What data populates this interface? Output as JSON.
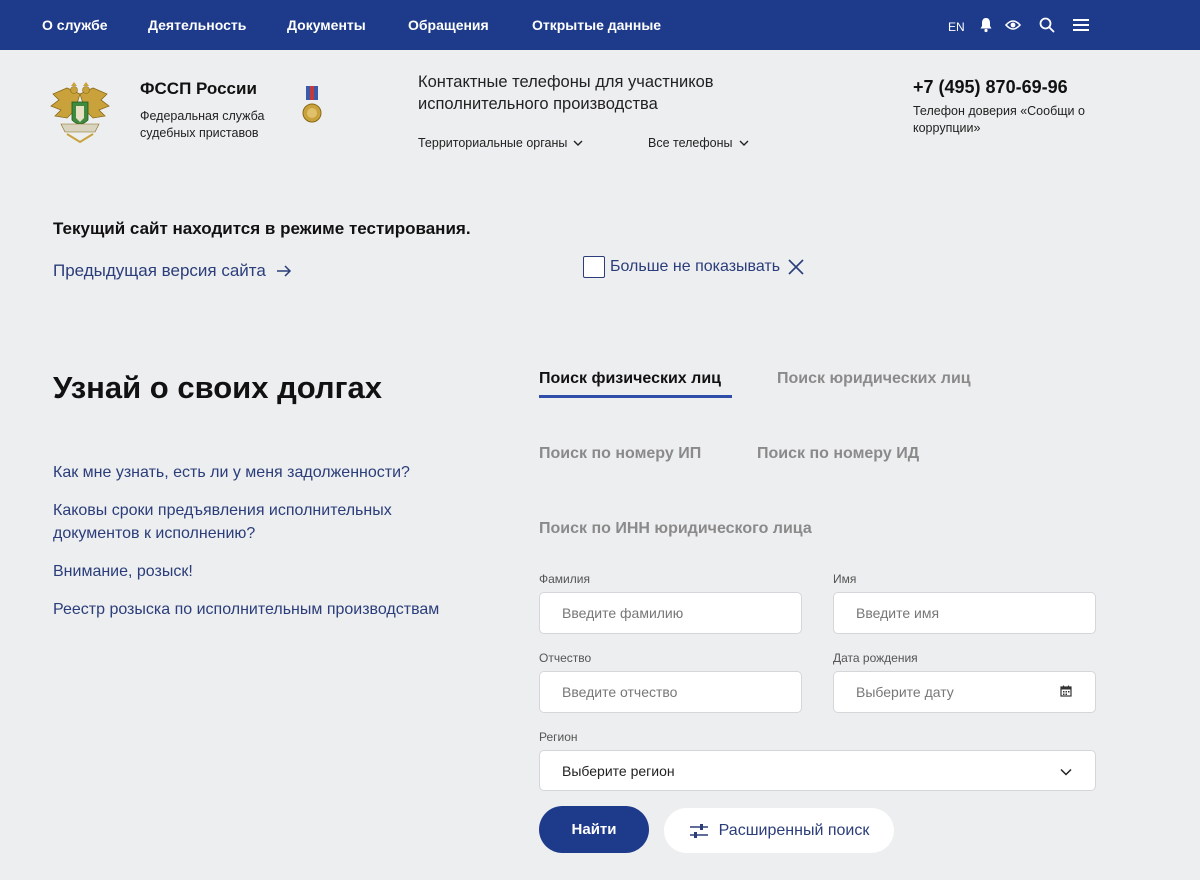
{
  "topnav": {
    "items": [
      "О службе",
      "Деятельность",
      "Документы",
      "Обращения",
      "Открытые данные"
    ],
    "lang": "EN",
    "icons": [
      "bell-icon",
      "eye-icon",
      "search-icon",
      "menu-icon"
    ]
  },
  "brand": {
    "title": "ФССП России",
    "subtitle": "Федеральная служба судебных приставов"
  },
  "contacts": {
    "title": "Контактные телефоны для участников исполнительного производства",
    "territorial": "Территориальные органы",
    "all_phones": "Все телефоны"
  },
  "hotline": {
    "phone": "+7 (495) 870-69-96",
    "label": "Телефон доверия «Сообщи о коррупции»"
  },
  "notice": {
    "text": "Текущий сайт находится в режиме тестирования.",
    "prev_link": "Предыдущая версия сайта",
    "dont_show": "Больше не показывать"
  },
  "debts": {
    "title": "Узнай о своих долгах",
    "faq": [
      "Как мне узнать, есть ли у меня задолженности?",
      "Каковы сроки предъявления исполнительных документов к исполнению?",
      "Внимание, розыск!",
      "Реестр розыска по исполнительным производствам"
    ]
  },
  "search": {
    "tabs": [
      "Поиск физических лиц",
      "Поиск юридических лиц",
      "Поиск по номеру ИП",
      "Поиск по номеру ИД",
      "Поиск по ИНН юридического лица"
    ],
    "fields": {
      "lastname": {
        "label": "Фамилия",
        "placeholder": "Введите фамилию"
      },
      "firstname": {
        "label": "Имя",
        "placeholder": "Введите имя"
      },
      "patronymic": {
        "label": "Отчество",
        "placeholder": "Введите отчество"
      },
      "birthdate": {
        "label": "Дата рождения",
        "placeholder": "Выберите дату"
      },
      "region": {
        "label": "Регион",
        "value": "Выберите регион"
      }
    },
    "find_button": "Найти",
    "advanced_button": "Расширенный поиск"
  },
  "colors": {
    "primary": "#1e3a8a",
    "link": "#2b3d7a",
    "background": "#eceeef",
    "tab_underline": "#2e4ea8"
  }
}
